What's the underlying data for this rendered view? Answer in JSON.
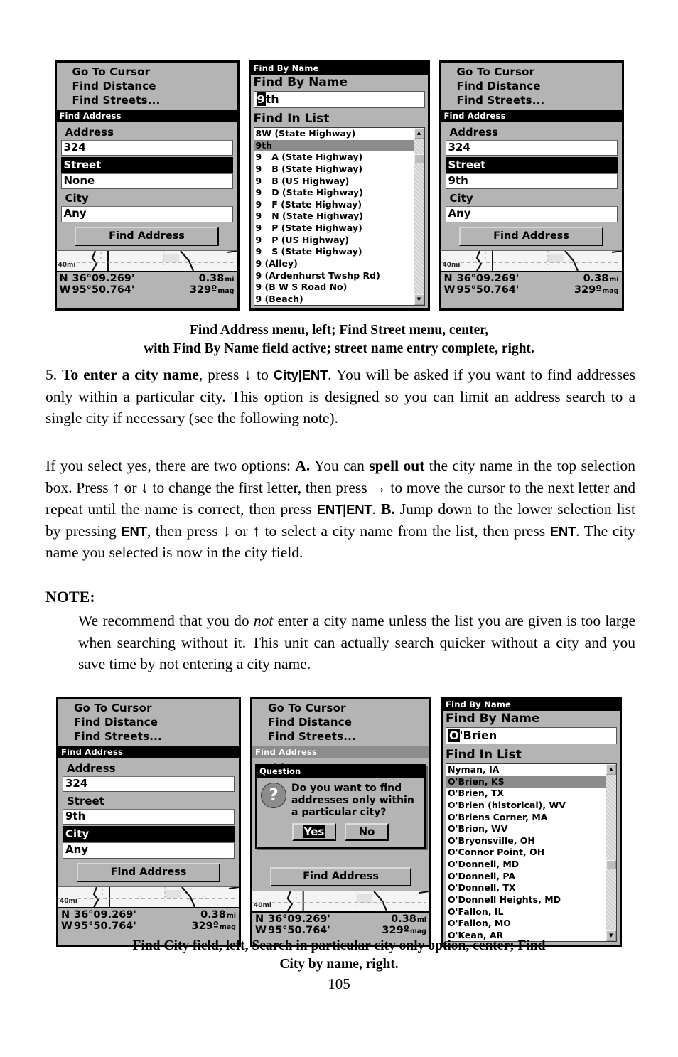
{
  "figures": {
    "top": [
      {
        "type": "find-address",
        "menu_items": [
          "Go To Cursor",
          "Find Distance",
          "Find Streets..."
        ],
        "title": "Find Address",
        "fields": [
          {
            "label": "Address",
            "value": "324",
            "highlighted": false
          },
          {
            "label": "Street",
            "value": "None",
            "highlighted": true
          },
          {
            "label": "City",
            "value": "Any",
            "highlighted": false
          }
        ],
        "button": "Find Address",
        "map_scale": "40mi",
        "status": {
          "lat_hemi": "N",
          "lat": "36°09.269'",
          "dist": "0.38",
          "dist_unit": "mi",
          "lon_hemi": "W",
          "lon": "95°50.764'",
          "bearing": "329º",
          "bearing_unit": "mag"
        }
      },
      {
        "type": "find-by-name",
        "title": "Find By Name",
        "name_label": "Find By Name",
        "input_cursor": "9",
        "input_rest": "th",
        "list_label": "Find In List",
        "list_items": [
          {
            "text": "8W (State Highway)",
            "selected": false
          },
          {
            "text": "9th",
            "selected": true
          },
          {
            "prefix": "9",
            "text": "A (State Highway)",
            "selected": false
          },
          {
            "prefix": "9",
            "text": "B (State Highway)",
            "selected": false
          },
          {
            "prefix": "9",
            "text": "B (US Highway)",
            "selected": false
          },
          {
            "prefix": "9",
            "text": "D (State Highway)",
            "selected": false
          },
          {
            "prefix": "9",
            "text": "F (State Highway)",
            "selected": false
          },
          {
            "prefix": "9",
            "text": "N (State Highway)",
            "selected": false
          },
          {
            "prefix": "9",
            "text": "P (State Highway)",
            "selected": false
          },
          {
            "prefix": "9",
            "text": "P (US Highway)",
            "selected": false
          },
          {
            "prefix": "9",
            "text": "S (State Highway)",
            "selected": false
          },
          {
            "text": "9 (Alley)",
            "selected": false
          },
          {
            "text": "9 (Ardenhurst Twshp Rd)",
            "selected": false
          },
          {
            "text": "9 (B W S Road No)",
            "selected": false
          },
          {
            "text": "9 (Beach)",
            "selected": false
          }
        ]
      },
      {
        "type": "find-address",
        "menu_items": [
          "Go To Cursor",
          "Find Distance",
          "Find Streets..."
        ],
        "title": "Find Address",
        "fields": [
          {
            "label": "Address",
            "value": "324",
            "highlighted": false
          },
          {
            "label": "Street",
            "value": "9th",
            "highlighted": true
          },
          {
            "label": "City",
            "value": "Any",
            "highlighted": false
          }
        ],
        "button": "Find Address",
        "map_scale": "40mi",
        "status": {
          "lat_hemi": "N",
          "lat": "36°09.269'",
          "dist": "0.38",
          "dist_unit": "mi",
          "lon_hemi": "W",
          "lon": "95°50.764'",
          "bearing": "329º",
          "bearing_unit": "mag"
        }
      }
    ],
    "top_caption_line1": "Find Address menu, left; Find Street menu, center,",
    "top_caption_line2": "with Find By Name field active; street name entry complete, right.",
    "bottom": [
      {
        "type": "find-address",
        "menu_items": [
          "Go To Cursor",
          "Find Distance",
          "Find Streets..."
        ],
        "title": "Find Address",
        "fields": [
          {
            "label": "Address",
            "value": "324",
            "highlighted": false
          },
          {
            "label": "Street",
            "value": "9th",
            "highlighted": false
          },
          {
            "label": "City",
            "value": "Any",
            "highlighted": true
          }
        ],
        "button": "Find Address",
        "map_scale": "40mi",
        "status": {
          "lat_hemi": "N",
          "lat": "36°09.269'",
          "dist": "0.38",
          "dist_unit": "mi",
          "lon_hemi": "W",
          "lon": "95°50.764'",
          "bearing": "329º",
          "bearing_unit": "mag"
        }
      },
      {
        "type": "question-dialog",
        "menu_items": [
          "Go To Cursor",
          "Find Distance",
          "Find Streets..."
        ],
        "title": "Find Address",
        "partial_field_label": "Address",
        "dialog": {
          "title": "Question",
          "icon": "question-mark-icon",
          "text": "Do you want to find addresses only within a particular city?",
          "buttons": [
            {
              "label": "Yes",
              "selected": true
            },
            {
              "label": "No",
              "selected": false
            }
          ]
        },
        "button": "Find Address",
        "map_scale": "40mi",
        "status": {
          "lat_hemi": "N",
          "lat": "36°09.269'",
          "dist": "0.38",
          "dist_unit": "mi",
          "lon_hemi": "W",
          "lon": "95°50.764'",
          "bearing": "329º",
          "bearing_unit": "mag"
        }
      },
      {
        "type": "find-by-name",
        "title": "Find By Name",
        "name_label": "Find By Name",
        "input_cursor": "O",
        "input_rest": "'Brien",
        "list_label": "Find In List",
        "list_items": [
          {
            "text": "Nyman, IA",
            "selected": false
          },
          {
            "text": "O'Brien, KS",
            "selected": true
          },
          {
            "text": "O'Brien, TX",
            "selected": false
          },
          {
            "text": "O'Brien (historical), WV",
            "selected": false
          },
          {
            "text": "O'Briens Corner, MA",
            "selected": false
          },
          {
            "text": "O'Brion, WV",
            "selected": false
          },
          {
            "text": "O'Bryonsville, OH",
            "selected": false
          },
          {
            "text": "O'Connor Point, OH",
            "selected": false
          },
          {
            "text": "O'Donnell, MD",
            "selected": false
          },
          {
            "text": "O'Donnell, PA",
            "selected": false
          },
          {
            "text": "O'Donnell, TX",
            "selected": false
          },
          {
            "text": "O'Donnell Heights, MD",
            "selected": false
          },
          {
            "text": "O'Fallon, IL",
            "selected": false
          },
          {
            "text": "O'Fallon, MO",
            "selected": false
          },
          {
            "text": "O'Kean, AR",
            "selected": false
          }
        ]
      }
    ],
    "bottom_caption_line1": "Find City field, left, Search in particular city only option, center; Find",
    "bottom_caption_line2": "City by name, right."
  },
  "prose": {
    "step5": {
      "number": "5.",
      "bold_lead": "To enter a city name",
      "t1": ", press ↓ to ",
      "key_city": "City",
      "key_sep": "|",
      "key_ent": "ENT",
      "t2": ". You will be asked if you want to find addresses only within a particular city. This option is designed so you can limit an address search to a single city if necessary (see the following note)."
    },
    "para2": {
      "t1": "If you select yes, there are two options: ",
      "a_label": "A.",
      "t2": " You can ",
      "bold_spell": "spell out",
      "t3": " the city name in the top selection box. Press ↑ or ↓ to change the first letter, then press → to move the cursor to the next letter and repeat until the name is correct, then press ",
      "key_ent1": "ENT",
      "key_sep": "|",
      "key_ent2": "ENT",
      "t4": ". ",
      "b_label": "B.",
      "t5": " Jump down to the lower selection list by pressing ",
      "key_ent3": "ENT",
      "t6": ", then press ↓ or ↑ to select a city name from the list, then press ",
      "key_ent4": "ENT",
      "t7": ". The city name you selected is now in the city field."
    },
    "note": {
      "heading": "NOTE:",
      "t1": "We recommend that you do ",
      "italic_not": "not",
      "t2": " enter a city name unless the list you are given is too large when searching without it. This unit can actually search quicker without a city and you save time by not entering a city name."
    },
    "page_number": "105"
  }
}
